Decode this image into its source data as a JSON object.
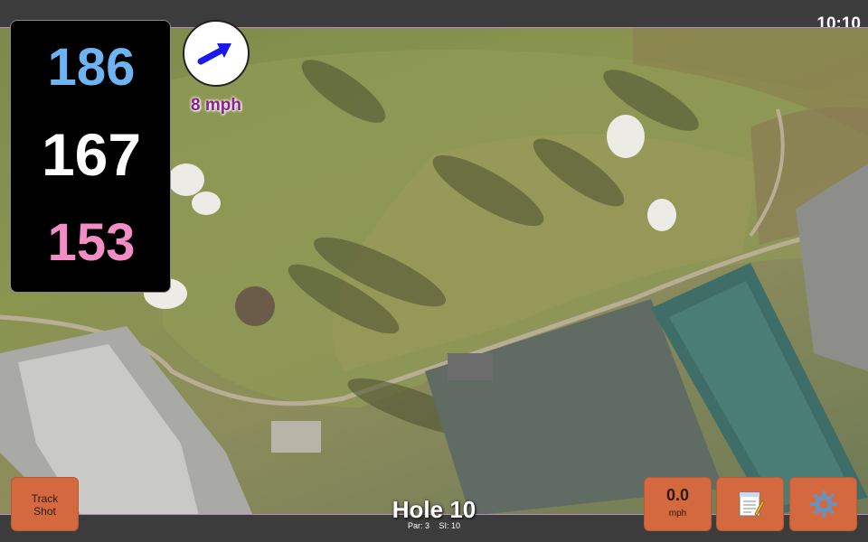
{
  "status": {
    "time": "10:10"
  },
  "yardages": {
    "back": "186",
    "center": "167",
    "front": "153"
  },
  "wind": {
    "speed_label": "8 mph",
    "direction_icon": "arrow-icon"
  },
  "hole": {
    "title": "Hole 10",
    "par": "Par: 3",
    "stroke_index": "SI: 10"
  },
  "controls": {
    "track_shot_line1": "Track",
    "track_shot_line2": "Shot",
    "speed_value": "0.0",
    "speed_unit": "mph",
    "notes_icon": "notepad-icon",
    "settings_icon": "gear-icon"
  },
  "colors": {
    "back_yardage": "#6fb4f2",
    "center_yardage": "#ffffff",
    "front_yardage": "#f28ec5",
    "button": "#d4683e",
    "wind_text": "#8e1f8e"
  }
}
